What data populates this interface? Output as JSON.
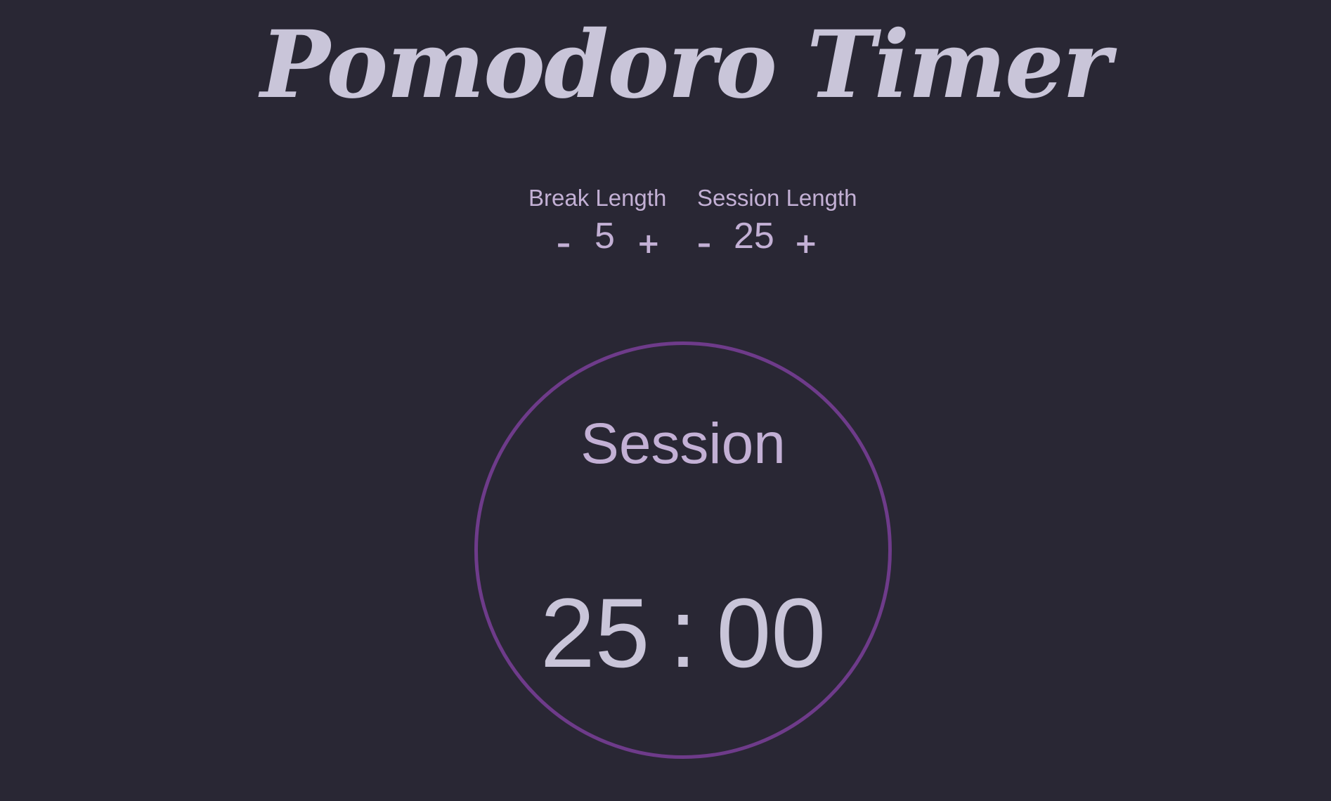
{
  "app": {
    "title": "Pomodoro Timer"
  },
  "break": {
    "label": "Break Length",
    "decrement_label": "–",
    "value": "5",
    "increment_label": "+"
  },
  "session": {
    "label": "Session Length",
    "decrement_label": "–",
    "value": "25",
    "increment_label": "+"
  },
  "timer": {
    "label": "Session",
    "minutes": "25",
    "separator": ":",
    "seconds": "00"
  },
  "colors": {
    "background": "#292734",
    "title": "#c9c5d9",
    "accent_text": "#c3b0d5",
    "ring": "#6e3b8a"
  }
}
